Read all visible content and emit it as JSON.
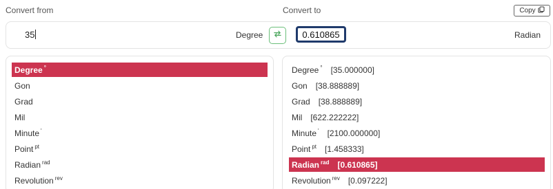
{
  "convert_from_label": "Convert from",
  "convert_to_label": "Convert to",
  "copy_label": "Copy",
  "from_value": "35",
  "from_unit": "Degree",
  "to_value": "0.610865",
  "to_unit": "Radian",
  "colors": {
    "selected": "#cc3450",
    "swap_accent": "#6bbf7a",
    "output_border": "#1f3a6b"
  },
  "icons": {
    "copy": "copy-icon",
    "swap": "swap-arrows-icon"
  },
  "from_units": [
    {
      "label": "Degree",
      "sup": "°",
      "selected": true
    },
    {
      "label": "Gon",
      "sup": ""
    },
    {
      "label": "Grad",
      "sup": ""
    },
    {
      "label": "Mil",
      "sup": ""
    },
    {
      "label": "Minute",
      "sup": "'"
    },
    {
      "label": "Point",
      "sup": "pt"
    },
    {
      "label": "Radian",
      "sup": "rad"
    },
    {
      "label": "Revolution",
      "sup": "rev"
    }
  ],
  "to_units": [
    {
      "label": "Degree",
      "sup": "°",
      "value": "[35.000000]"
    },
    {
      "label": "Gon",
      "sup": "",
      "value": "[38.888889]"
    },
    {
      "label": "Grad",
      "sup": "",
      "value": "[38.888889]"
    },
    {
      "label": "Mil",
      "sup": "",
      "value": "[622.222222]"
    },
    {
      "label": "Minute",
      "sup": "'",
      "value": "[2100.000000]"
    },
    {
      "label": "Point",
      "sup": "pt",
      "value": "[1.458333]"
    },
    {
      "label": "Radian",
      "sup": "rad",
      "value": "[0.610865]",
      "selected": true
    },
    {
      "label": "Revolution",
      "sup": "rev",
      "value": "[0.097222]"
    }
  ]
}
